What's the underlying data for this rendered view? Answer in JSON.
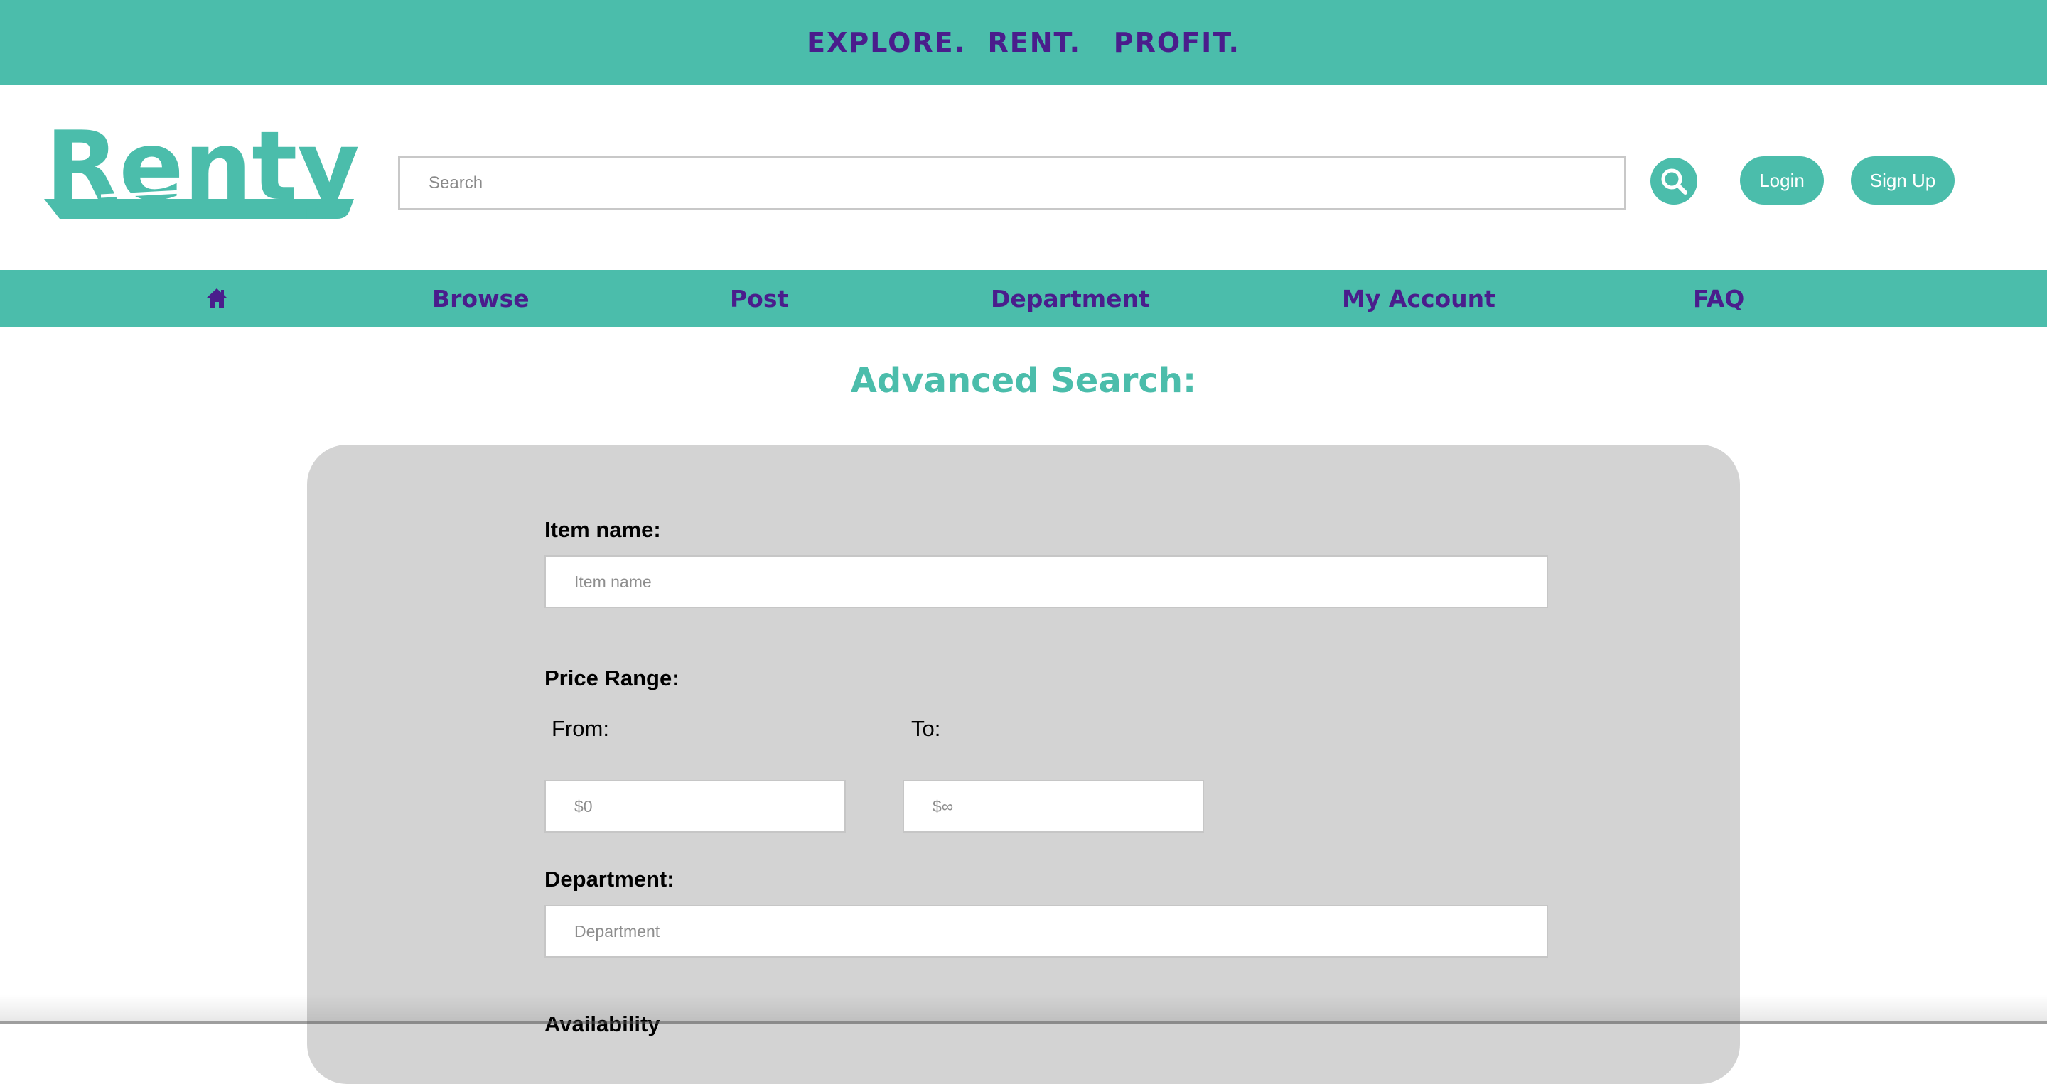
{
  "banner": {
    "tagline": "EXPLORE.  RENT.   PROFIT."
  },
  "header": {
    "logo_text": "Renty",
    "search": {
      "placeholder": "Search",
      "value": ""
    },
    "login_label": "Login",
    "signup_label": "Sign Up"
  },
  "nav": {
    "items": [
      {
        "label": "",
        "icon": "home-icon"
      },
      {
        "label": "Browse"
      },
      {
        "label": "Post"
      },
      {
        "label": "Department"
      },
      {
        "label": "My Account"
      },
      {
        "label": "FAQ"
      }
    ]
  },
  "main": {
    "heading": "Advanced Search:",
    "form": {
      "item_name": {
        "label": "Item name:",
        "placeholder": "Item name"
      },
      "price_range": {
        "label": "Price Range:",
        "from_label": "From:",
        "to_label": "To:",
        "from_placeholder": "$0",
        "to_placeholder": "$∞"
      },
      "department": {
        "label": "Department:",
        "placeholder": "Department"
      },
      "availability": {
        "label": "Availability"
      }
    }
  },
  "colors": {
    "brand_teal": "#4bbdab",
    "brand_purple": "#4a1d8c",
    "panel_gray": "#d3d3d3"
  }
}
